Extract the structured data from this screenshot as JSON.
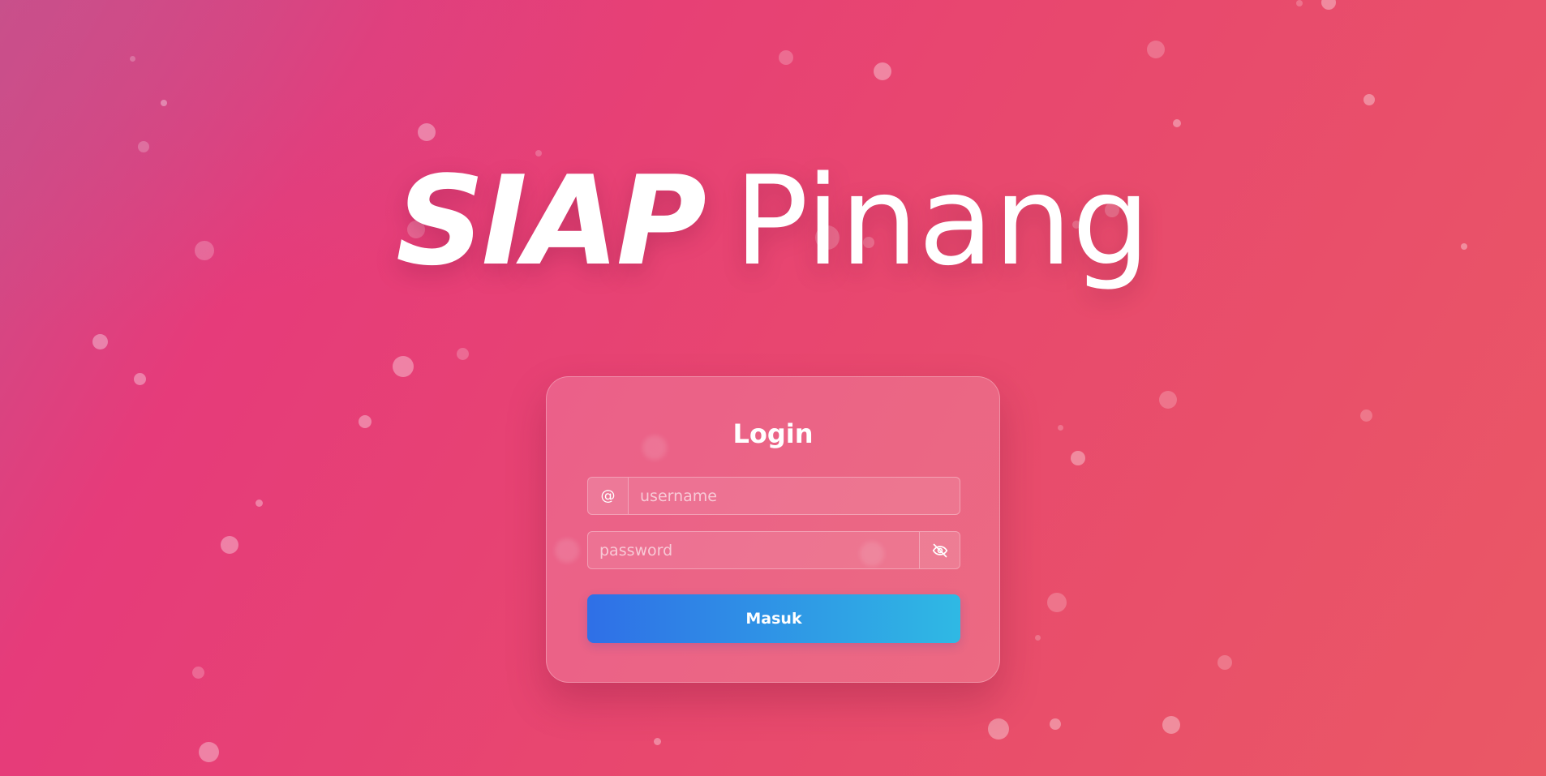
{
  "brand": {
    "title_bold": "SIAP",
    "title_light": "Pinang"
  },
  "login_card": {
    "title": "Login",
    "username": {
      "prefix_symbol": "@",
      "placeholder": "username",
      "value": ""
    },
    "password": {
      "placeholder": "password",
      "value": "",
      "toggle_icon": "eye-slash-icon"
    },
    "submit_label": "Masuk"
  },
  "colors": {
    "background_start": "#c94f8a",
    "background_mid": "#e63b7a",
    "background_end": "#ea5865",
    "button_start": "#2f6fe7",
    "button_end": "#2fb9e4"
  }
}
